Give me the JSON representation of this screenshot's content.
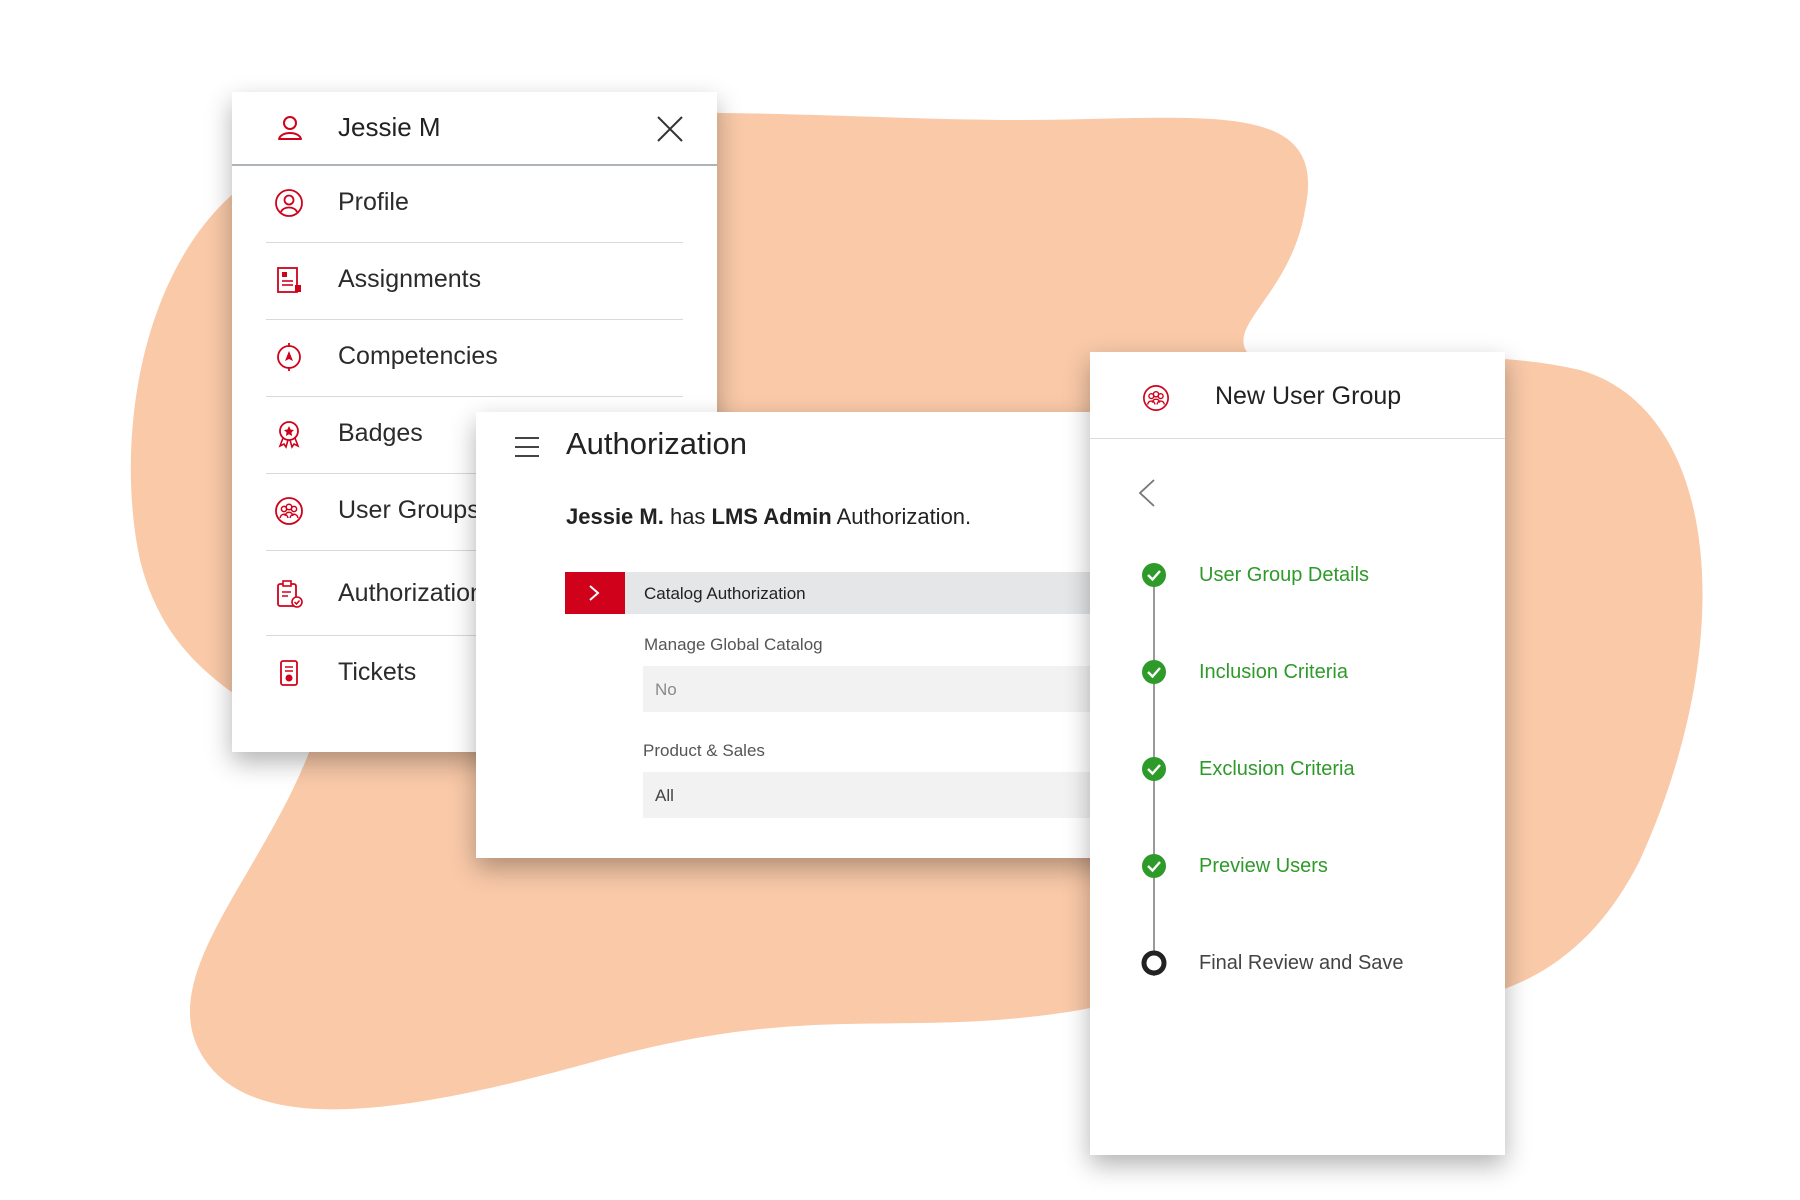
{
  "colors": {
    "blob": "#f9c9a8",
    "brand_red": "#d0021b",
    "success_green": "#2e9a2a"
  },
  "user_menu": {
    "user_name": "Jessie M",
    "header_icon": "user-icon",
    "close_icon": "close-icon",
    "items": [
      {
        "label": "Profile",
        "icon": "profile-icon"
      },
      {
        "label": "Assignments",
        "icon": "assignments-icon"
      },
      {
        "label": "Competencies",
        "icon": "competencies-icon"
      },
      {
        "label": "Badges",
        "icon": "badge-icon"
      },
      {
        "label": "User Groups",
        "icon": "user-groups-icon"
      },
      {
        "label": "Authorizations",
        "icon": "authorizations-icon"
      },
      {
        "label": "Tickets",
        "icon": "tickets-icon"
      }
    ]
  },
  "authorization": {
    "title": "Authorization",
    "message": {
      "name": "Jessie M.",
      "has": " has ",
      "role": "LMS Admin",
      "suffix": " Authorization."
    },
    "section": {
      "label": "Catalog Authorization",
      "expanded": false
    },
    "fields": [
      {
        "label": "Manage Global Catalog",
        "value": "No"
      },
      {
        "label": "Product & Sales",
        "value": "All"
      }
    ]
  },
  "new_user_group": {
    "title": "New User Group",
    "steps": [
      {
        "label": "User Group Details",
        "status": "complete"
      },
      {
        "label": "Inclusion Criteria",
        "status": "complete"
      },
      {
        "label": "Exclusion Criteria",
        "status": "complete"
      },
      {
        "label": "Preview Users",
        "status": "complete"
      },
      {
        "label": "Final Review and Save",
        "status": "current"
      }
    ]
  }
}
